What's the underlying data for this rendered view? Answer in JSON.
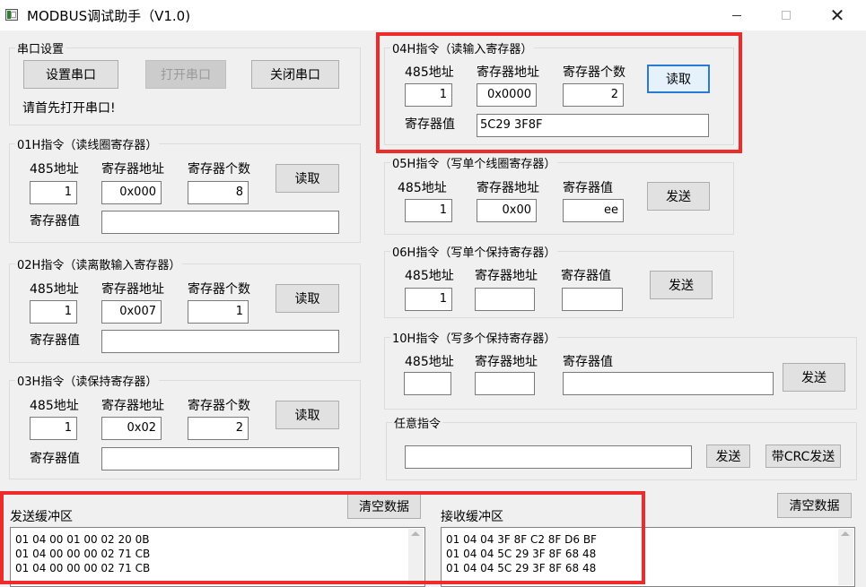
{
  "window": {
    "title": "MODBUS调试助手（V1.0)"
  },
  "serial": {
    "group_title": "串口设置",
    "setup_button": "设置串口",
    "open_button": "打开串口",
    "close_button": "关闭串口",
    "status": "请首先打开串口!"
  },
  "labels": {
    "addr485": "485地址",
    "reg_addr": "寄存器地址",
    "reg_count": "寄存器个数",
    "reg_value": "寄存器值",
    "read": "读取",
    "send": "发送"
  },
  "fc01": {
    "title": "01H指令（读线圈寄存器）",
    "addr": "1",
    "reg_addr": "0x000",
    "count": "8",
    "value": ""
  },
  "fc02": {
    "title": "02H指令（读离散输入寄存器）",
    "addr": "1",
    "reg_addr": "0x007",
    "count": "1",
    "value": ""
  },
  "fc03": {
    "title": "03H指令（读保持寄存器）",
    "addr": "1",
    "reg_addr": "0x02",
    "count": "2",
    "value": ""
  },
  "fc04": {
    "title": "04H指令（读输入寄存器）",
    "addr": "1",
    "reg_addr": "0x0000",
    "count": "2",
    "value": "5C29 3F8F"
  },
  "fc05": {
    "title": "05H指令（写单个线圈寄存器）",
    "addr": "1",
    "reg_addr": "0x00",
    "value": "ee"
  },
  "fc06": {
    "title": "06H指令（写单个保持寄存器）",
    "addr": "1",
    "reg_addr": "",
    "value": ""
  },
  "fc10": {
    "title": "10H指令（写多个保持寄存器）",
    "addr": "",
    "reg_addr": "",
    "value": ""
  },
  "custom": {
    "title": "任意指令",
    "command": "",
    "send_button": "发送",
    "send_crc_button": "带CRC发送"
  },
  "send_buffer": {
    "label": "发送缓冲区",
    "clear_button": "清空数据",
    "lines": [
      "01 04 00 01 00 02 20 0B",
      "01 04 00 00 00 02 71 CB",
      "01 04 00 00 00 02 71 CB"
    ]
  },
  "recv_buffer": {
    "label": "接收缓冲区",
    "clear_button": "清空数据",
    "lines": [
      "01 04 04 3F 8F C2 8F D6 BF",
      "01 04 04 5C 29 3F 8F 68 48",
      "01 04 04 5C 29 3F 8F 68 48"
    ]
  },
  "colors": {
    "highlight": "#ee2b2b",
    "focus": "#2b78d6"
  }
}
